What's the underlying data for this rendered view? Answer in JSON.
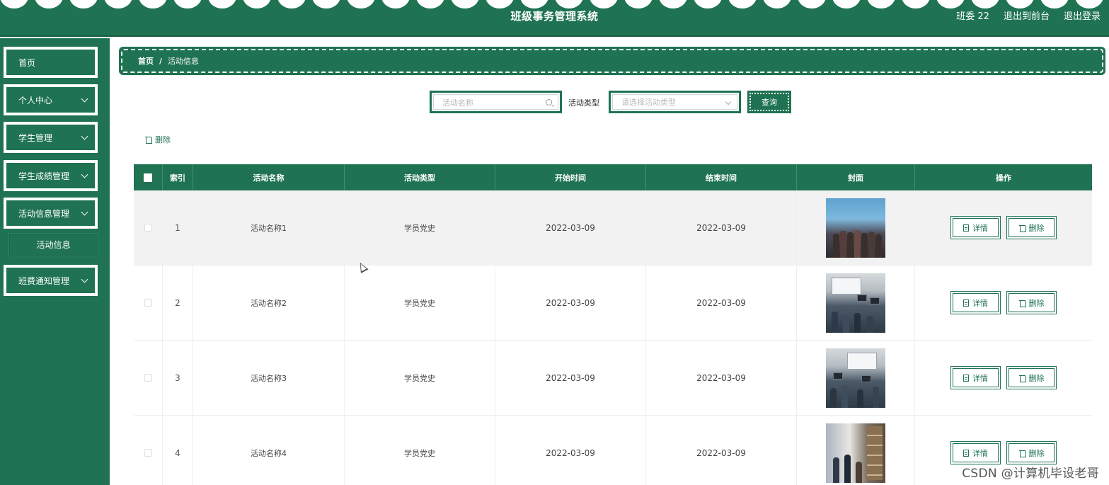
{
  "header": {
    "title": "班级事务管理系统",
    "user": "班委 22",
    "to_front": "退出到前台",
    "logout": "退出登录"
  },
  "sidebar": {
    "items": [
      {
        "label": "首页"
      },
      {
        "label": "个人中心"
      },
      {
        "label": "学生管理"
      },
      {
        "label": "学生成绩管理"
      },
      {
        "label": "活动信息管理"
      },
      {
        "label": "班费通知管理"
      }
    ],
    "submenu": {
      "label": "活动信息"
    }
  },
  "breadcrumb": {
    "home": "首页",
    "separator": "/",
    "current": "活动信息"
  },
  "search": {
    "name_placeholder": "活动名称",
    "type_label": "活动类型",
    "type_placeholder": "请选择活动类型",
    "query_button": "查询"
  },
  "toolbar": {
    "delete_label": "删除"
  },
  "table": {
    "headers": {
      "index": "索引",
      "name": "活动名称",
      "type": "活动类型",
      "start": "开始时间",
      "end": "结束时间",
      "cover": "封面",
      "ops": "操作"
    },
    "rows": [
      {
        "index": "1",
        "name": "活动名称1",
        "type": "学员党史",
        "start": "2022-03-09",
        "end": "2022-03-09"
      },
      {
        "index": "2",
        "name": "活动名称2",
        "type": "学员党史",
        "start": "2022-03-09",
        "end": "2022-03-09"
      },
      {
        "index": "3",
        "name": "活动名称3",
        "type": "学员党史",
        "start": "2022-03-09",
        "end": "2022-03-09"
      },
      {
        "index": "4",
        "name": "活动名称4",
        "type": "学员党史",
        "start": "2022-03-09",
        "end": "2022-03-09"
      }
    ],
    "detail_label": "详情",
    "delete_label": "删除"
  },
  "watermark": "CSDN @计算机毕设老哥",
  "colors": {
    "primary": "#1f7352",
    "white": "#ffffff"
  },
  "icons": {
    "search": "search-icon",
    "chevron": "chevron-down-icon",
    "trash": "trash-icon",
    "detail": "document-icon"
  }
}
